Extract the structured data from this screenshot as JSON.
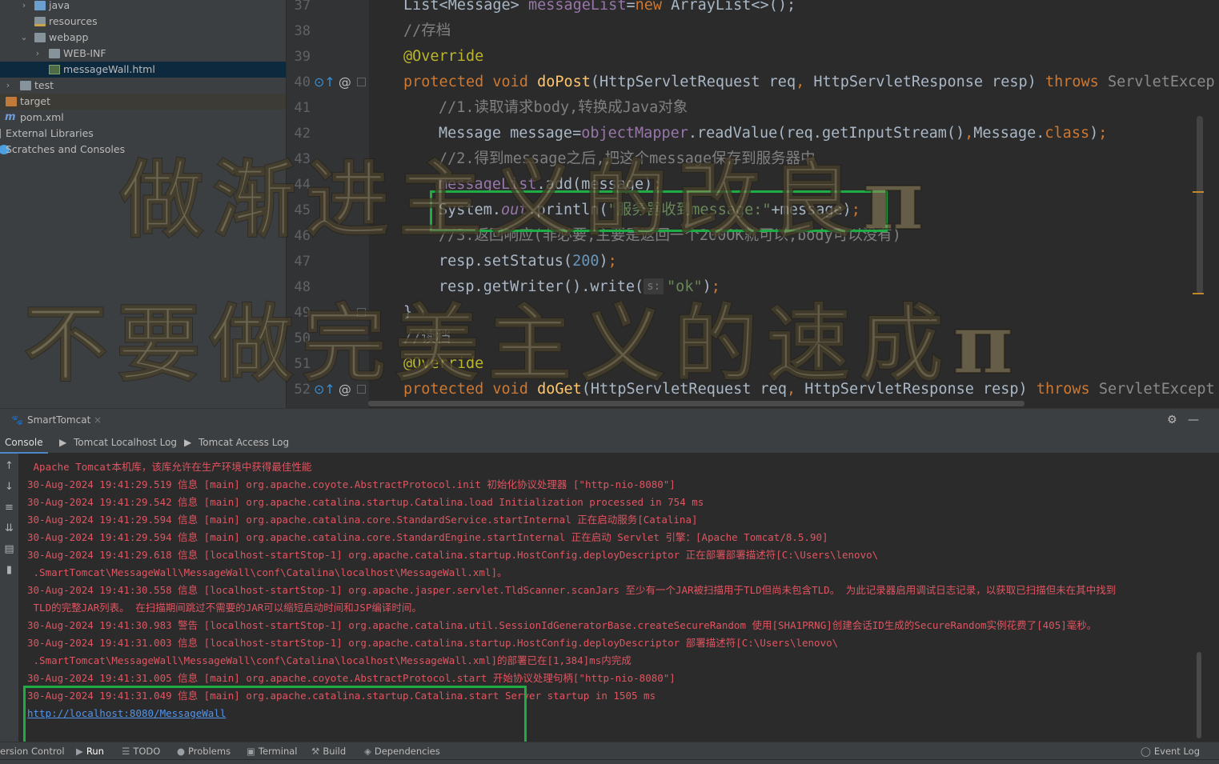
{
  "project_tree": {
    "items": [
      {
        "label": "java",
        "depth": 2,
        "expanded": false
      },
      {
        "label": "resources",
        "depth": 2
      },
      {
        "label": "webapp",
        "depth": 2,
        "expanded": true
      },
      {
        "label": "WEB-INF",
        "depth": 3,
        "expanded": false
      },
      {
        "label": "messageWall.html",
        "depth": 4,
        "selected": true
      },
      {
        "label": "test",
        "depth": 1,
        "expanded": false
      },
      {
        "label": "target",
        "depth": 1
      },
      {
        "label": "pom.xml",
        "depth": 1
      },
      {
        "label": "External Libraries",
        "depth": 0
      },
      {
        "label": "Scratches and Consoles",
        "depth": 0
      }
    ],
    "maven_icon": "m"
  },
  "editor": {
    "line_numbers": [
      "37",
      "38",
      "39",
      "40",
      "41",
      "42",
      "43",
      "44",
      "45",
      "46",
      "47",
      "48",
      "49",
      "50",
      "51",
      "52"
    ],
    "lines": {
      "l37": {
        "t1": "List<Message> ",
        "t2": "messageList",
        "t3": "=",
        "t4": "new ",
        "t5": "ArrayList<>();"
      },
      "l38": {
        "c": "//存档"
      },
      "l39": {
        "a": "@Override"
      },
      "l40": {
        "k1": "protected void ",
        "f": "doPost",
        "t1": "(HttpServletRequest req",
        "p1": ", ",
        "t2": "HttpServletResponse resp) ",
        "k2": "throws ",
        "t3": "ServletExcep"
      },
      "l41": {
        "c": "//1.读取请求body,转换成Java对象"
      },
      "l42": {
        "t1": "Message message=",
        "v": "objectMapper",
        "t2": ".readValue(req.getInputStream()",
        "p": ",",
        "t3": "Message.",
        "k": "class",
        "t4": ")",
        "s": ";"
      },
      "l43": {
        "c": "//2.得到message之后,把这个message保存到服务器中"
      },
      "l44": {
        "v": "messageList",
        "t1": ".add(message)",
        "s": ";"
      },
      "l45": {
        "t1": "System.",
        "sf": "out",
        "t2": ".println(",
        "str": "\"服务器收到message:\"",
        "t3": "+message)",
        "s": ";"
      },
      "l46": {
        "c": "//3.返回响应(非必要,主要是返回一个200OK就可以,body可以没有)"
      },
      "l47": {
        "t1": "resp.setStatus(",
        "n": "200",
        "t2": ")",
        "s": ";"
      },
      "l48": {
        "t1": "resp.getWriter().write(",
        "hint": "s:",
        "str": "\"ok\"",
        "t2": ")",
        "s": ";"
      },
      "l49": {
        "t1": "}"
      },
      "l50": {
        "c": "//读档"
      },
      "l51": {
        "a": "@Override"
      },
      "l52": {
        "k1": "protected void ",
        "f": "doGet",
        "t1": "(HttpServletRequest req",
        "p1": ", ",
        "t2": "HttpServletResponse resp) ",
        "k2": "throws ",
        "t3": "ServletExcept"
      }
    },
    "watermark": {
      "line1": "做渐进主义的改良π",
      "line2": "不要做完美主义的速成π"
    }
  },
  "run_panel": {
    "config_name": "SmartTomcat",
    "tabs": [
      "Console",
      "Tomcat Localhost Log",
      "Tomcat Access Log"
    ],
    "log_lines": [
      " Apache Tomcat本机库，该库允许在生产环境中获得最佳性能",
      "30-Aug-2024 19:41:29.519 信息 [main] org.apache.coyote.AbstractProtocol.init 初始化协议处理器 [\"http-nio-8080\"]",
      "30-Aug-2024 19:41:29.542 信息 [main] org.apache.catalina.startup.Catalina.load Initialization processed in 754 ms",
      "30-Aug-2024 19:41:29.594 信息 [main] org.apache.catalina.core.StandardService.startInternal 正在启动服务[Catalina]",
      "30-Aug-2024 19:41:29.594 信息 [main] org.apache.catalina.core.StandardEngine.startInternal 正在启动 Servlet 引擎：[Apache Tomcat/8.5.90]",
      "30-Aug-2024 19:41:29.618 信息 [localhost-startStop-1] org.apache.catalina.startup.HostConfig.deployDescriptor 正在部署部署描述符[C:\\Users\\lenovo\\",
      " .SmartTomcat\\MessageWall\\MessageWall\\conf\\Catalina\\localhost\\MessageWall.xml]。",
      "30-Aug-2024 19:41:30.558 信息 [localhost-startStop-1] org.apache.jasper.servlet.TldScanner.scanJars 至少有一个JAR被扫描用于TLD但尚未包含TLD。 为此记录器启用调试日志记录，以获取已扫描但未在其中找到",
      " TLD的完整JAR列表。 在扫描期间跳过不需要的JAR可以缩短启动时间和JSP编译时间。",
      "30-Aug-2024 19:41:30.983 警告 [localhost-startStop-1] org.apache.catalina.util.SessionIdGeneratorBase.createSecureRandom 使用[SHA1PRNG]创建会话ID生成的SecureRandom实例花费了[405]毫秒。",
      "30-Aug-2024 19:41:31.003 信息 [localhost-startStop-1] org.apache.catalina.startup.HostConfig.deployDescriptor 部署描述符[C:\\Users\\lenovo\\",
      " .SmartTomcat\\MessageWall\\MessageWall\\conf\\Catalina\\localhost\\MessageWall.xml]的部署已在[1,384]ms内完成",
      "30-Aug-2024 19:41:31.005 信息 [main] org.apache.coyote.AbstractProtocol.start 开始协议处理句柄[\"http-nio-8080\"]",
      "30-Aug-2024 19:41:31.049 信息 [main] org.apache.catalina.startup.Catalina.start Server startup in 1505 ms"
    ],
    "url": "http://localhost:8080/MessageWall"
  },
  "bottom_bar": {
    "items": [
      "ersion Control",
      "Run",
      "TODO",
      "Problems",
      "Terminal",
      "Build",
      "Dependencies"
    ],
    "event_log": "Event Log"
  },
  "colors": {
    "highlight_box": "#1fad43",
    "log_red": "#e05561",
    "link_blue": "#5394ec"
  }
}
